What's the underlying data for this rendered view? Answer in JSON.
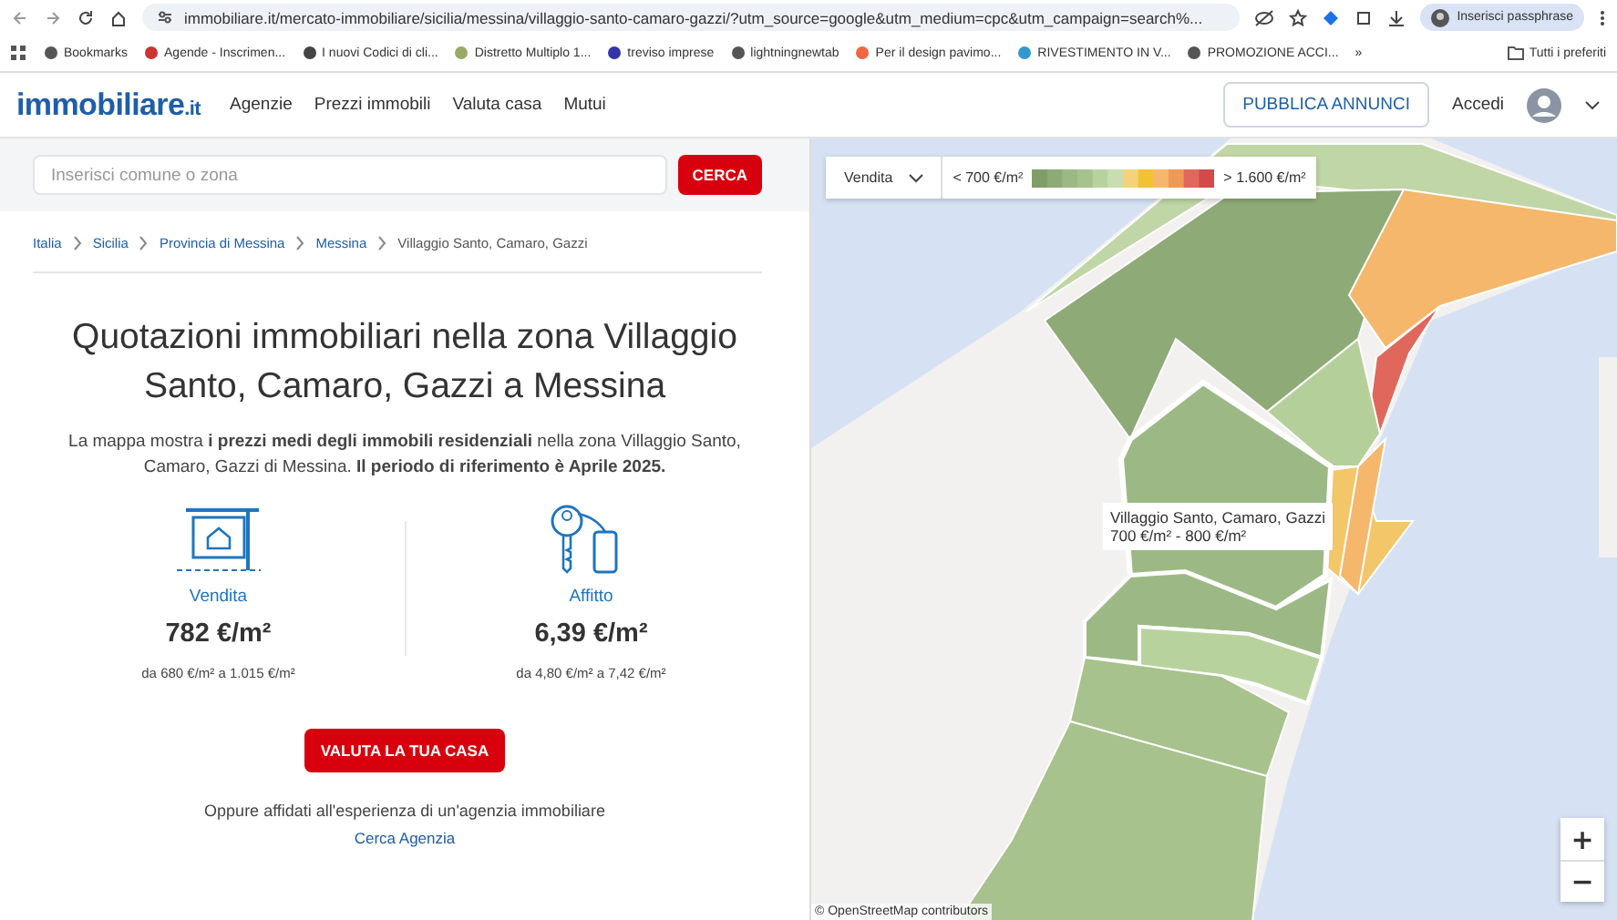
{
  "browser": {
    "url": "immobiliare.it/mercato-immobiliare/sicilia/messina/villaggio-santo-camaro-gazzi/?utm_source=google&utm_medium=cpc&utm_campaign=search%...",
    "profile": "Inserisci passphrase",
    "bookmarks": [
      {
        "label": "Bookmarks"
      },
      {
        "label": "Agende - Inscrimen..."
      },
      {
        "label": "I nuovi Codici di cli..."
      },
      {
        "label": "Distretto Multiplo 1..."
      },
      {
        "label": "treviso imprese"
      },
      {
        "label": "lightningnewtab"
      },
      {
        "label": "Per il design pavimo..."
      },
      {
        "label": "RIVESTIMENTO IN V..."
      },
      {
        "label": "PROMOZIONE ACCI..."
      }
    ],
    "more": "»",
    "all_bookmarks": "Tutti i preferiti"
  },
  "header": {
    "logo": "immobiliare",
    "logo_suffix": ".it",
    "nav": [
      "Agenzie",
      "Prezzi immobili",
      "Valuta casa",
      "Mutui"
    ],
    "publish": "PUBBLICA ANNUNCI",
    "login": "Accedi"
  },
  "search": {
    "placeholder": "Inserisci comune o zona",
    "button": "CERCA"
  },
  "breadcrumb": [
    {
      "label": "Italia",
      "link": true
    },
    {
      "label": "Sicilia",
      "link": true
    },
    {
      "label": "Provincia di Messina",
      "link": true
    },
    {
      "label": "Messina",
      "link": true
    },
    {
      "label": "Villaggio Santo, Camaro, Gazzi",
      "link": false
    }
  ],
  "title": "Quotazioni immobiliari nella zona Villaggio Santo, Camaro, Gazzi a Messina",
  "intro": "La mappa mostra **i prezzi medi degli immobili residenziali** nella zona Villaggio Santo, Camaro, Gazzi di Messina. **Il periodo di riferimento è Aprile 2025.**",
  "stats": [
    {
      "kind": "sale",
      "label": "Vendita",
      "value": "782 €/m²",
      "range": "da 680 €/m² a 1.015 €/m²"
    },
    {
      "kind": "rent",
      "label": "Affitto",
      "value": "6,39 €/m²",
      "range": "da 4,80 €/m² a 7,42 €/m²"
    }
  ],
  "valuate_button": "VALUTA LA TUA CASA",
  "agency_text": "Oppure affidati all'esperienza di un'agenzia immobiliare",
  "agency_link": "Cerca Agenzia",
  "map": {
    "mode": "Vendita",
    "legend_min": "< 700 €/m²",
    "legend_max": "> 1.600 €/m²",
    "tooltip": {
      "zone": "Villaggio Santo, Camaro, Gazzi",
      "range": "700 €/m² - 800 €/m²"
    },
    "zoom_in": "+",
    "zoom_out": "−",
    "attribution": "© OpenStreetMap contributors"
  }
}
